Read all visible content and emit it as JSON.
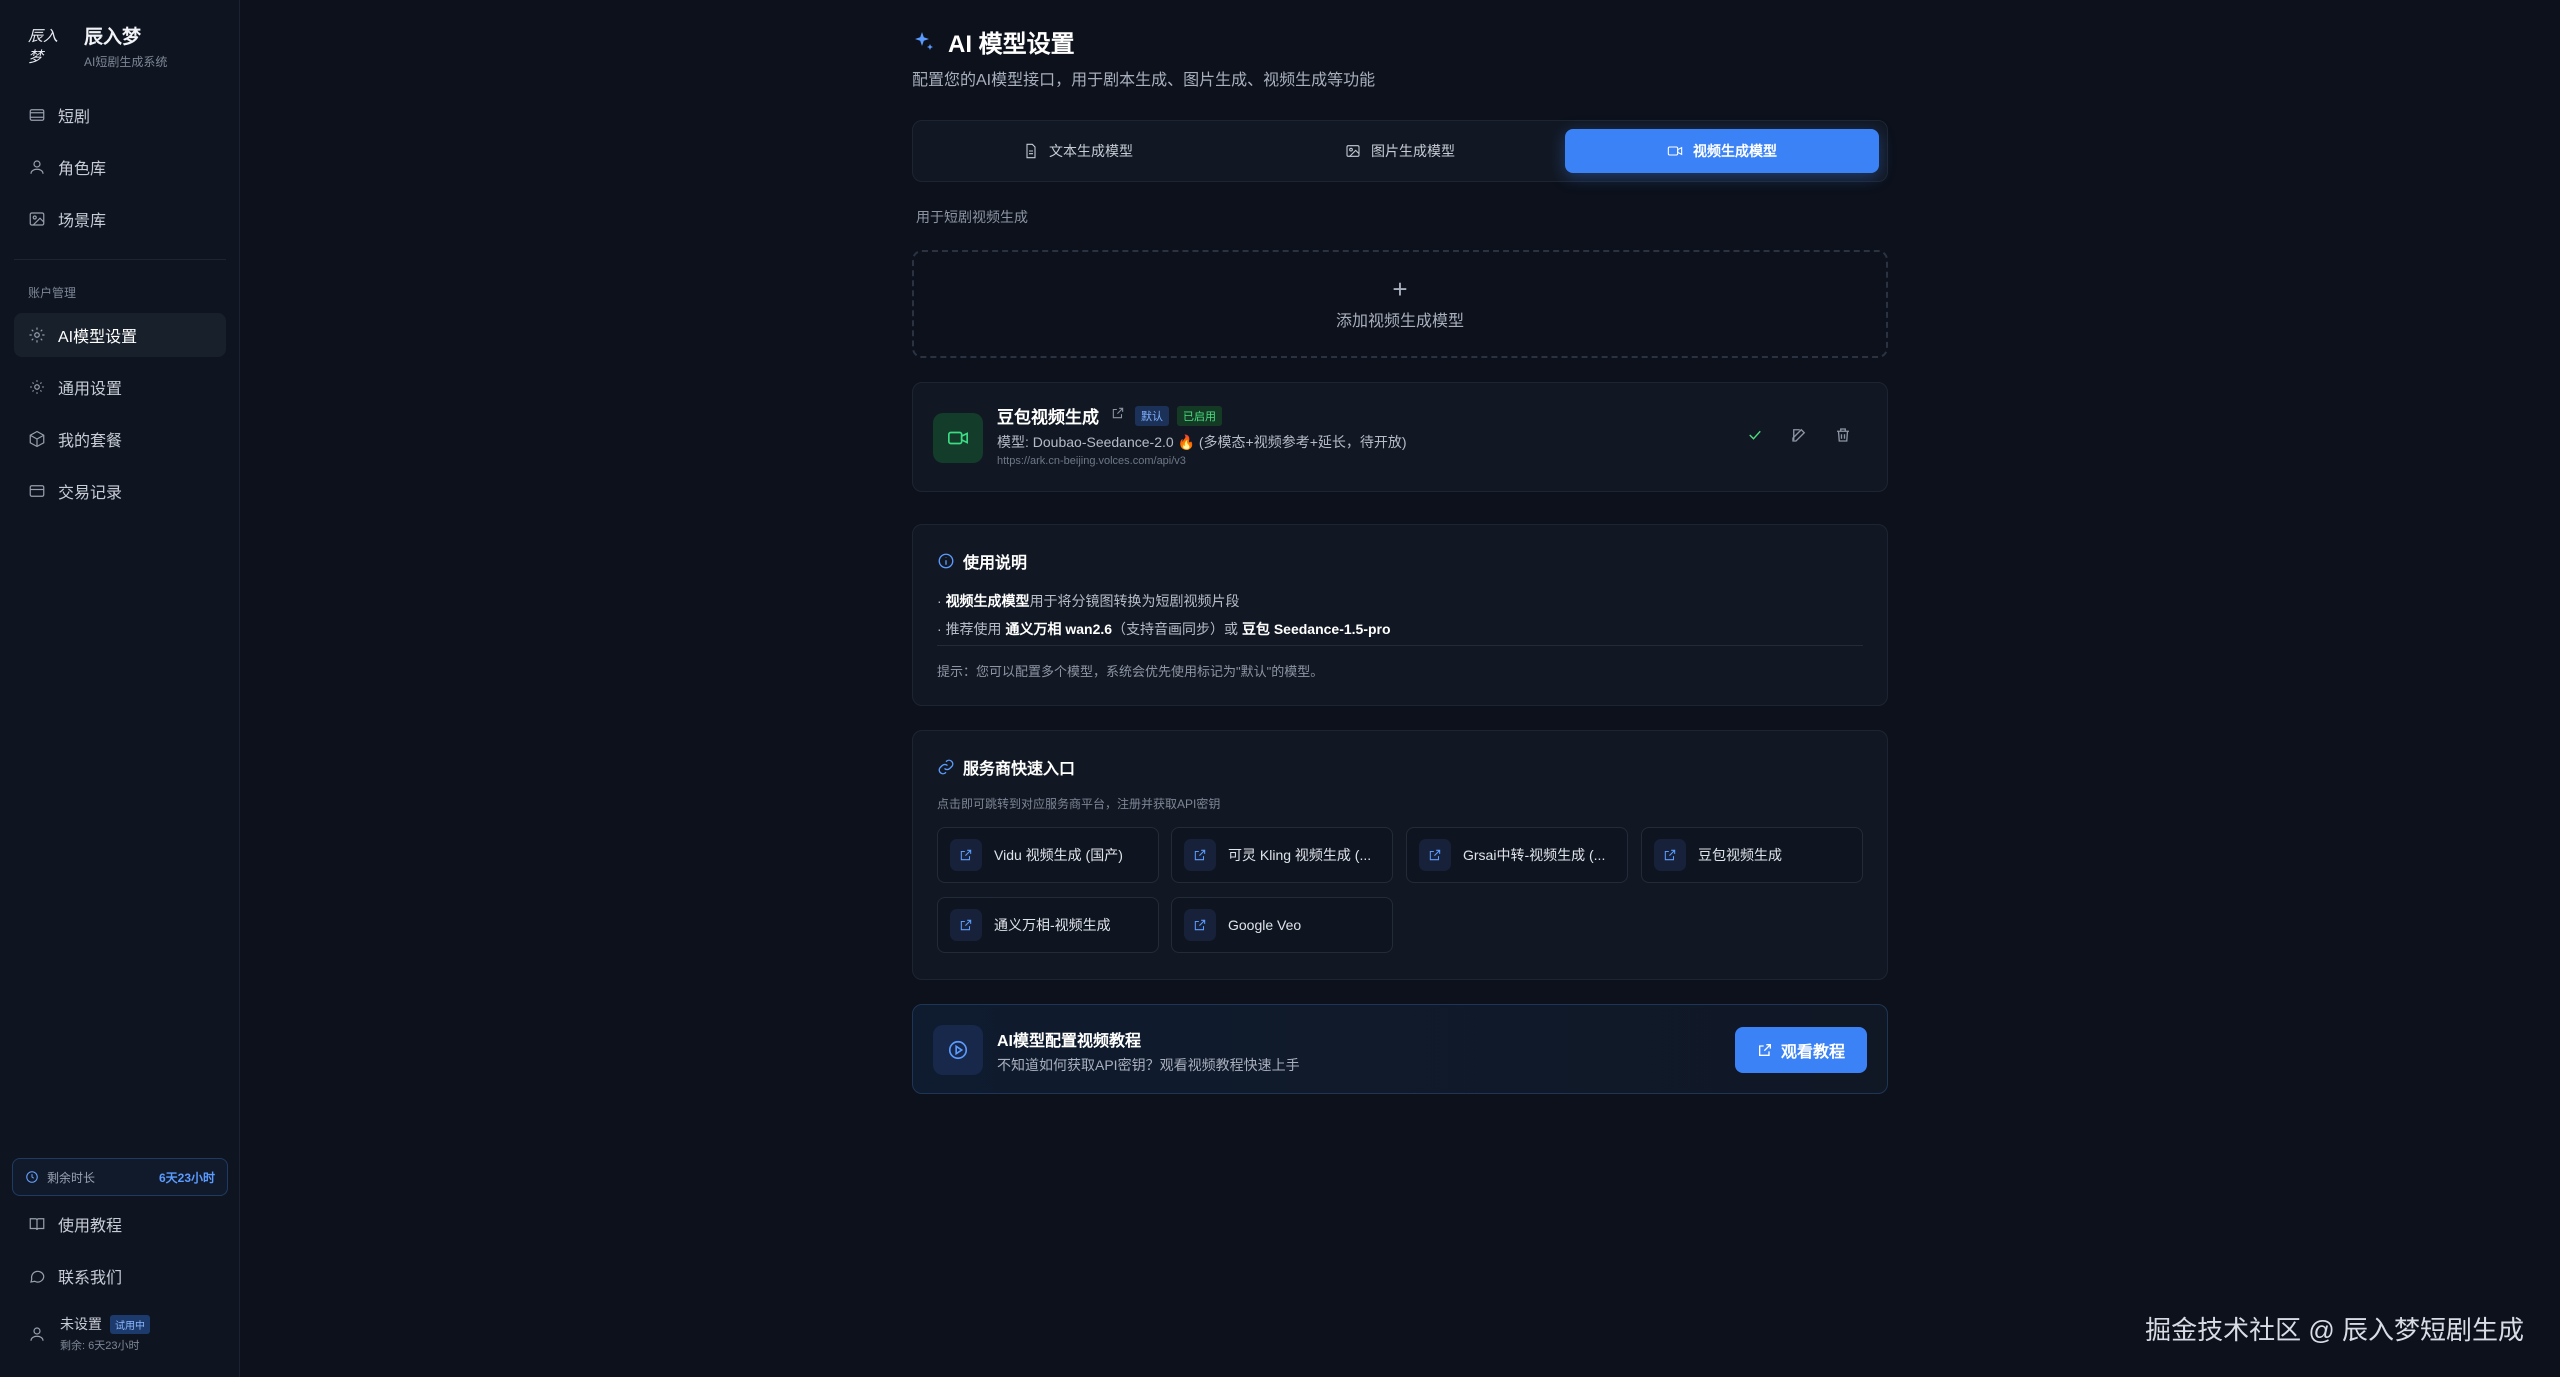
{
  "sidebar": {
    "brand_logo": "辰入梦",
    "brand_title": "辰入梦",
    "brand_subtitle": "AI短剧生成系统",
    "items": [
      {
        "label": "短剧",
        "icon": "film-icon"
      },
      {
        "label": "角色库",
        "icon": "user-icon"
      },
      {
        "label": "场景库",
        "icon": "image-icon"
      }
    ],
    "section_label": "账户管理",
    "account_items": [
      {
        "label": "AI模型设置",
        "icon": "sparkle-gear-icon",
        "active": true
      },
      {
        "label": "通用设置",
        "icon": "gear-icon"
      },
      {
        "label": "我的套餐",
        "icon": "package-icon"
      },
      {
        "label": "交易记录",
        "icon": "card-icon"
      }
    ],
    "remain_label": "剩余时长",
    "remain_value": "6天23小时",
    "bottom_items": [
      {
        "label": "使用教程",
        "icon": "book-icon"
      },
      {
        "label": "联系我们",
        "icon": "chat-icon"
      }
    ],
    "user": {
      "name": "未设置",
      "badge": "试用中",
      "sub": "剩余: 6天23小时"
    }
  },
  "main": {
    "title": "AI 模型设置",
    "description": "配置您的AI模型接口，用于剧本生成、图片生成、视频生成等功能",
    "tabs": [
      {
        "label": "文本生成模型",
        "active": false
      },
      {
        "label": "图片生成模型",
        "active": false
      },
      {
        "label": "视频生成模型",
        "active": true
      }
    ],
    "section_hint": "用于短剧视频生成",
    "add_label": "添加视频生成模型",
    "model": {
      "name": "豆包视频生成",
      "tag_default": "默认",
      "tag_enabled": "已启用",
      "model_line": "模型: Doubao-Seedance-2.0 🔥 (多模态+视频参考+延长，待开放)",
      "url": "https://ark.cn-beijing.volces.com/api/v3"
    },
    "usage": {
      "title": "使用说明",
      "line1_bold": "视频生成模型",
      "line1_rest": "用于将分镜图转换为短剧视频片段",
      "line2_pre": "推荐使用 ",
      "line2_bold1": "通义万相 wan2.6",
      "line2_mid": "（支持音画同步）或 ",
      "line2_bold2": "豆包 Seedance-1.5-pro",
      "tip": "提示：您可以配置多个模型，系统会优先使用标记为\"默认\"的模型。"
    },
    "providers": {
      "title": "服务商快速入口",
      "hint": "点击即可跳转到对应服务商平台，注册并获取API密钥",
      "items": [
        "Vidu 视频生成 (国产)",
        "可灵 Kling 视频生成 (...",
        "Grsai中转-视频生成 (...",
        "豆包视频生成",
        "通义万相-视频生成",
        "Google Veo"
      ]
    },
    "tutorial": {
      "title": "AI模型配置视频教程",
      "description": "不知道如何获取API密钥？观看视频教程快速上手",
      "button": "观看教程"
    }
  },
  "watermark": "掘金技术社区 @ 辰入梦短剧生成",
  "colors": {
    "accent": "#3b82f6",
    "success": "#4ade80",
    "background": "#0c111b"
  }
}
